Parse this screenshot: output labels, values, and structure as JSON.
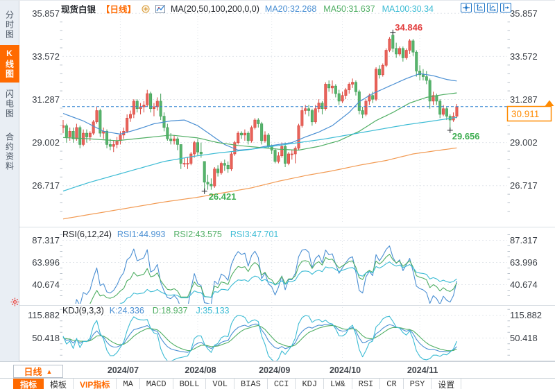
{
  "sidebar": {
    "tabs": [
      {
        "label": "分时图",
        "active": false
      },
      {
        "label": "K线图",
        "active": true
      },
      {
        "label": "闪电图",
        "active": false
      },
      {
        "label": "合约资料",
        "active": false
      }
    ]
  },
  "header": {
    "symbol": "现货白银",
    "period": "【日线】",
    "plus_icon": "circle-plus-icon",
    "chart_icon": "indicator-chart-icon",
    "ma_title": "MA(20,50,100,200,0,0)",
    "ma_values": [
      {
        "label": "MA20:32.268",
        "color": "#4a8fd3"
      },
      {
        "label": "MA50:31.637",
        "color": "#4fae63"
      },
      {
        "label": "MA100:30.34",
        "color": "#3bbbd4"
      }
    ]
  },
  "top_icons": [
    {
      "name": "crosshair-icon"
    },
    {
      "name": "axis-scale-up-icon"
    },
    {
      "name": "axis-scale-right-icon"
    },
    {
      "name": "goto-latest-icon"
    }
  ],
  "panes": {
    "rsi": {
      "title": "RSI(6,12,24)",
      "values": [
        {
          "label": "RSI1:44.993",
          "color": "#4a8fd3"
        },
        {
          "label": "RSI2:43.575",
          "color": "#4fae63"
        },
        {
          "label": "RSI3:47.701",
          "color": "#3bbbd4"
        }
      ]
    },
    "kdj": {
      "title": "KDJ(9,3,3)",
      "values": [
        {
          "label": "K:24.336",
          "color": "#4a8fd3"
        },
        {
          "label": "D:18.937",
          "color": "#4fae63"
        },
        {
          "label": "J:35.133",
          "color": "#3bbbd4"
        }
      ]
    }
  },
  "price_tag": {
    "value": "30.911",
    "color": "#ff8a00"
  },
  "xaxis": {
    "period_label": "日线",
    "arrow": "▲"
  },
  "toolbar": {
    "items": [
      {
        "label": "指标",
        "style": "active"
      },
      {
        "label": "模板",
        "style": ""
      },
      {
        "label": "VIP指标",
        "style": "vip"
      },
      {
        "label": "MA",
        "style": "mono"
      },
      {
        "label": "MACD",
        "style": "mono"
      },
      {
        "label": "BOLL",
        "style": "mono"
      },
      {
        "label": "VOL",
        "style": "mono"
      },
      {
        "label": "BIAS",
        "style": "mono"
      },
      {
        "label": "CCI",
        "style": "mono"
      },
      {
        "label": "KDJ",
        "style": "mono"
      },
      {
        "label": "LW&",
        "style": "mono"
      },
      {
        "label": "RSI",
        "style": "mono"
      },
      {
        "label": "CR",
        "style": "mono"
      },
      {
        "label": "PSY",
        "style": "mono"
      },
      {
        "label": "设置",
        "style": ""
      }
    ]
  },
  "chart_data": {
    "type": "candlestick",
    "symbol": "现货白银",
    "period": "日线",
    "current_price": 30.911,
    "y_axis": {
      "main": [
        35.857,
        33.572,
        31.287,
        29.002,
        26.717
      ],
      "rsi": [
        87.317,
        63.996,
        40.674
      ],
      "kdj": [
        115.882,
        50.418
      ]
    },
    "x_axis_months": [
      {
        "label": "2024/07",
        "index": 17
      },
      {
        "label": "2024/08",
        "index": 40
      },
      {
        "label": "2024/09",
        "index": 62
      },
      {
        "label": "2024/10",
        "index": 83
      },
      {
        "label": "2024/11",
        "index": 106
      }
    ],
    "annotations": [
      {
        "type": "high",
        "index": 98,
        "price": 34.846,
        "label": "34.846",
        "color": "#e23c3c"
      },
      {
        "type": "low",
        "index": 42,
        "price": 26.421,
        "label": "26.421",
        "color": "#3fae52"
      },
      {
        "type": "low",
        "index": 115,
        "price": 29.656,
        "label": "29.656",
        "color": "#3fae52"
      }
    ],
    "candle_colors": {
      "up": "#e8635a",
      "up_border": "#d8443c",
      "down": "#57b46c",
      "down_border": "#3f9e55"
    },
    "candles": [
      [
        29.8,
        30.2,
        29.5,
        29.9
      ],
      [
        29.9,
        30.0,
        29.0,
        29.3
      ],
      [
        29.3,
        29.8,
        29.1,
        29.6
      ],
      [
        29.6,
        29.8,
        29.0,
        29.2
      ],
      [
        29.2,
        30.0,
        29.1,
        29.8
      ],
      [
        29.8,
        29.9,
        28.7,
        28.9
      ],
      [
        28.9,
        29.7,
        28.8,
        29.5
      ],
      [
        29.5,
        29.7,
        29.0,
        29.3
      ],
      [
        29.3,
        29.6,
        29.1,
        29.5
      ],
      [
        29.5,
        30.2,
        29.4,
        30.1
      ],
      [
        30.1,
        30.9,
        30.0,
        30.7
      ],
      [
        30.7,
        30.8,
        29.3,
        29.5
      ],
      [
        29.5,
        29.8,
        29.2,
        29.6
      ],
      [
        29.6,
        29.7,
        28.7,
        28.9
      ],
      [
        28.9,
        29.2,
        28.6,
        28.8
      ],
      [
        28.8,
        29.1,
        28.5,
        28.9
      ],
      [
        28.9,
        29.3,
        28.7,
        29.1
      ],
      [
        29.1,
        29.6,
        28.9,
        29.4
      ],
      [
        29.4,
        29.8,
        29.2,
        29.6
      ],
      [
        29.6,
        30.5,
        29.5,
        30.3
      ],
      [
        30.3,
        30.7,
        30.1,
        30.5
      ],
      [
        30.5,
        31.3,
        30.3,
        31.2
      ],
      [
        31.2,
        31.3,
        30.6,
        30.8
      ],
      [
        30.8,
        31.1,
        30.5,
        30.9
      ],
      [
        30.9,
        31.2,
        30.6,
        31.0
      ],
      [
        31.0,
        31.8,
        30.9,
        31.6
      ],
      [
        31.6,
        31.7,
        30.6,
        30.8
      ],
      [
        30.8,
        31.1,
        30.4,
        30.9
      ],
      [
        30.9,
        31.4,
        30.7,
        31.2
      ],
      [
        31.2,
        31.6,
        30.2,
        30.4
      ],
      [
        30.4,
        30.6,
        29.6,
        29.8
      ],
      [
        29.8,
        30.0,
        29.1,
        29.2
      ],
      [
        29.2,
        29.5,
        28.9,
        29.1
      ],
      [
        29.1,
        29.4,
        28.9,
        29.2
      ],
      [
        29.2,
        29.3,
        28.6,
        28.9
      ],
      [
        28.9,
        28.9,
        27.6,
        27.9
      ],
      [
        27.9,
        28.2,
        27.7,
        27.9
      ],
      [
        27.9,
        28.2,
        27.6,
        27.9
      ],
      [
        27.9,
        28.5,
        27.8,
        28.4
      ],
      [
        28.4,
        29.1,
        28.2,
        29.0
      ],
      [
        29.0,
        29.2,
        28.3,
        28.5
      ],
      [
        28.5,
        29.0,
        28.2,
        28.4
      ],
      [
        28.0,
        28.0,
        26.421,
        26.9
      ],
      [
        26.9,
        27.3,
        26.5,
        26.8
      ],
      [
        26.8,
        27.1,
        26.5,
        26.7
      ],
      [
        26.7,
        27.7,
        26.6,
        27.6
      ],
      [
        27.6,
        27.8,
        27.2,
        27.4
      ],
      [
        27.4,
        28.0,
        27.3,
        27.9
      ],
      [
        27.9,
        28.1,
        27.5,
        27.8
      ],
      [
        27.8,
        28.0,
        27.4,
        27.6
      ],
      [
        27.6,
        28.5,
        27.5,
        28.4
      ],
      [
        28.4,
        29.1,
        28.3,
        29.0
      ],
      [
        29.0,
        29.6,
        28.9,
        29.5
      ],
      [
        29.5,
        29.6,
        29.2,
        29.4
      ],
      [
        29.4,
        29.7,
        29.1,
        29.5
      ],
      [
        29.5,
        29.6,
        28.9,
        29.1
      ],
      [
        29.1,
        29.9,
        29.0,
        29.8
      ],
      [
        29.8,
        30.3,
        29.7,
        30.2
      ],
      [
        30.2,
        30.3,
        29.8,
        30.0
      ],
      [
        30.0,
        30.1,
        28.9,
        29.1
      ],
      [
        29.1,
        29.6,
        29.0,
        29.4
      ],
      [
        29.4,
        29.5,
        28.7,
        28.8
      ],
      [
        28.8,
        28.9,
        28.4,
        28.6
      ],
      [
        28.6,
        28.7,
        27.9,
        28.0
      ],
      [
        28.0,
        28.5,
        27.9,
        28.3
      ],
      [
        28.3,
        29.0,
        28.2,
        28.8
      ],
      [
        28.8,
        29.0,
        27.7,
        27.9
      ],
      [
        27.9,
        28.5,
        27.8,
        28.4
      ],
      [
        28.4,
        28.6,
        28.1,
        28.4
      ],
      [
        28.4,
        28.8,
        27.9,
        28.7
      ],
      [
        28.7,
        30.0,
        28.6,
        29.9
      ],
      [
        29.9,
        30.9,
        29.8,
        30.7
      ],
      [
        30.7,
        31.0,
        30.5,
        30.8
      ],
      [
        30.8,
        31.0,
        30.4,
        30.7
      ],
      [
        30.7,
        30.8,
        29.9,
        30.1
      ],
      [
        30.1,
        31.0,
        30.0,
        30.8
      ],
      [
        30.8,
        31.3,
        30.6,
        31.1
      ],
      [
        31.1,
        31.2,
        30.5,
        30.8
      ],
      [
        30.8,
        32.2,
        30.7,
        32.1
      ],
      [
        32.1,
        32.3,
        31.7,
        31.9
      ],
      [
        31.9,
        32.3,
        31.6,
        32.0
      ],
      [
        32.0,
        32.1,
        31.4,
        31.6
      ],
      [
        31.6,
        31.8,
        31.0,
        31.2
      ],
      [
        31.2,
        31.7,
        31.1,
        31.5
      ],
      [
        31.5,
        31.9,
        31.3,
        31.8
      ],
      [
        31.8,
        32.2,
        31.6,
        32.1
      ],
      [
        32.1,
        32.4,
        31.9,
        32.2
      ],
      [
        32.2,
        32.3,
        31.5,
        31.7
      ],
      [
        31.7,
        31.8,
        30.5,
        30.7
      ],
      [
        30.7,
        30.9,
        30.3,
        30.5
      ],
      [
        30.5,
        31.3,
        30.4,
        31.2
      ],
      [
        31.2,
        31.6,
        31.0,
        31.5
      ],
      [
        31.5,
        31.7,
        31.1,
        31.3
      ],
      [
        31.3,
        33.0,
        31.2,
        32.9
      ],
      [
        32.9,
        33.1,
        32.4,
        32.6
      ],
      [
        32.6,
        33.2,
        32.5,
        33.1
      ],
      [
        33.1,
        34.0,
        33.0,
        33.9
      ],
      [
        33.9,
        34.6,
        33.8,
        34.5
      ],
      [
        34.7,
        34.846,
        33.8,
        34.0
      ],
      [
        34.0,
        34.3,
        33.5,
        33.7
      ],
      [
        33.7,
        34.1,
        33.6,
        34.0
      ],
      [
        34.0,
        34.1,
        33.3,
        33.5
      ],
      [
        33.5,
        34.0,
        33.4,
        33.9
      ],
      [
        33.9,
        34.5,
        33.7,
        34.4
      ],
      [
        34.4,
        34.5,
        33.6,
        33.8
      ],
      [
        33.8,
        33.9,
        32.5,
        32.8
      ],
      [
        32.8,
        33.1,
        32.3,
        32.6
      ],
      [
        32.6,
        32.9,
        32.3,
        32.5
      ],
      [
        32.5,
        32.8,
        32.1,
        32.3
      ],
      [
        32.3,
        32.4,
        30.8,
        31.2
      ],
      [
        31.2,
        31.7,
        31.0,
        31.5
      ],
      [
        31.5,
        31.6,
        31.0,
        31.2
      ],
      [
        31.2,
        31.3,
        30.3,
        30.5
      ],
      [
        30.5,
        31.0,
        30.4,
        30.8
      ],
      [
        30.8,
        30.9,
        30.2,
        30.4
      ],
      [
        30.4,
        30.5,
        29.656,
        30.2
      ],
      [
        30.2,
        30.6,
        30.1,
        30.4
      ],
      [
        30.4,
        31.05,
        30.3,
        30.911
      ]
    ],
    "ma_lines": [
      {
        "name": "MA20",
        "color": "#4a8fd3",
        "points": [
          [
            0,
            30.55
          ],
          [
            6,
            30.15
          ],
          [
            12,
            29.6
          ],
          [
            17,
            29.45
          ],
          [
            22,
            29.7
          ],
          [
            27,
            30.0
          ],
          [
            32,
            30.15
          ],
          [
            36,
            30.2
          ],
          [
            40,
            29.9
          ],
          [
            44,
            29.4
          ],
          [
            48,
            28.9
          ],
          [
            52,
            28.6
          ],
          [
            56,
            28.65
          ],
          [
            60,
            28.8
          ],
          [
            64,
            28.9
          ],
          [
            68,
            29.0
          ],
          [
            72,
            29.3
          ],
          [
            76,
            29.56
          ],
          [
            80,
            29.9
          ],
          [
            85,
            30.6
          ],
          [
            88,
            31.17
          ],
          [
            92,
            31.6
          ],
          [
            97,
            32.0
          ],
          [
            102,
            32.4
          ],
          [
            106,
            32.66
          ],
          [
            110,
            32.55
          ],
          [
            114,
            32.35
          ],
          [
            117,
            32.268
          ]
        ]
      },
      {
        "name": "MA50",
        "color": "#4fae63",
        "points": [
          [
            0,
            29.27
          ],
          [
            8,
            29.2
          ],
          [
            16,
            29.1
          ],
          [
            24,
            29.25
          ],
          [
            32,
            29.4
          ],
          [
            40,
            29.25
          ],
          [
            46,
            29.0
          ],
          [
            52,
            28.85
          ],
          [
            58,
            28.75
          ],
          [
            64,
            28.65
          ],
          [
            70,
            28.6
          ],
          [
            76,
            28.8
          ],
          [
            82,
            29.1
          ],
          [
            88,
            29.6
          ],
          [
            93,
            30.17
          ],
          [
            98,
            30.6
          ],
          [
            103,
            31.1
          ],
          [
            108,
            31.4
          ],
          [
            113,
            31.55
          ],
          [
            117,
            31.637
          ]
        ]
      },
      {
        "name": "MA100",
        "color": "#3bbbd4",
        "points": [
          [
            0,
            26.43
          ],
          [
            8,
            26.9
          ],
          [
            16,
            27.3
          ],
          [
            24,
            27.7
          ],
          [
            30,
            28.0
          ],
          [
            38,
            28.25
          ],
          [
            46,
            28.45
          ],
          [
            54,
            28.6
          ],
          [
            62,
            28.8
          ],
          [
            70,
            29.0
          ],
          [
            78,
            29.2
          ],
          [
            86,
            29.45
          ],
          [
            94,
            29.7
          ],
          [
            102,
            29.95
          ],
          [
            110,
            30.15
          ],
          [
            117,
            30.34
          ]
        ]
      },
      {
        "name": "MA200",
        "color": "#f29a52",
        "points": [
          [
            0,
            24.95
          ],
          [
            10,
            25.25
          ],
          [
            20,
            25.55
          ],
          [
            30,
            25.85
          ],
          [
            40,
            26.1
          ],
          [
            48,
            26.35
          ],
          [
            56,
            26.6
          ],
          [
            64,
            26.95
          ],
          [
            72,
            27.25
          ],
          [
            80,
            27.5
          ],
          [
            88,
            27.8
          ],
          [
            96,
            28.05
          ],
          [
            104,
            28.4
          ],
          [
            110,
            28.55
          ],
          [
            117,
            28.72
          ]
        ]
      }
    ],
    "indicators": {
      "rsi": {
        "periods": [
          6,
          12,
          24
        ],
        "colors": [
          "#4a8fd3",
          "#4fae63",
          "#3bbbd4"
        ],
        "last_values": [
          44.993,
          43.575,
          47.701
        ]
      },
      "kdj": {
        "periods": [
          9,
          3,
          3
        ],
        "colors": [
          "#4a8fd3",
          "#4fae63",
          "#3bbbd4"
        ],
        "last_values": [
          24.336,
          18.937,
          35.133
        ]
      }
    }
  }
}
